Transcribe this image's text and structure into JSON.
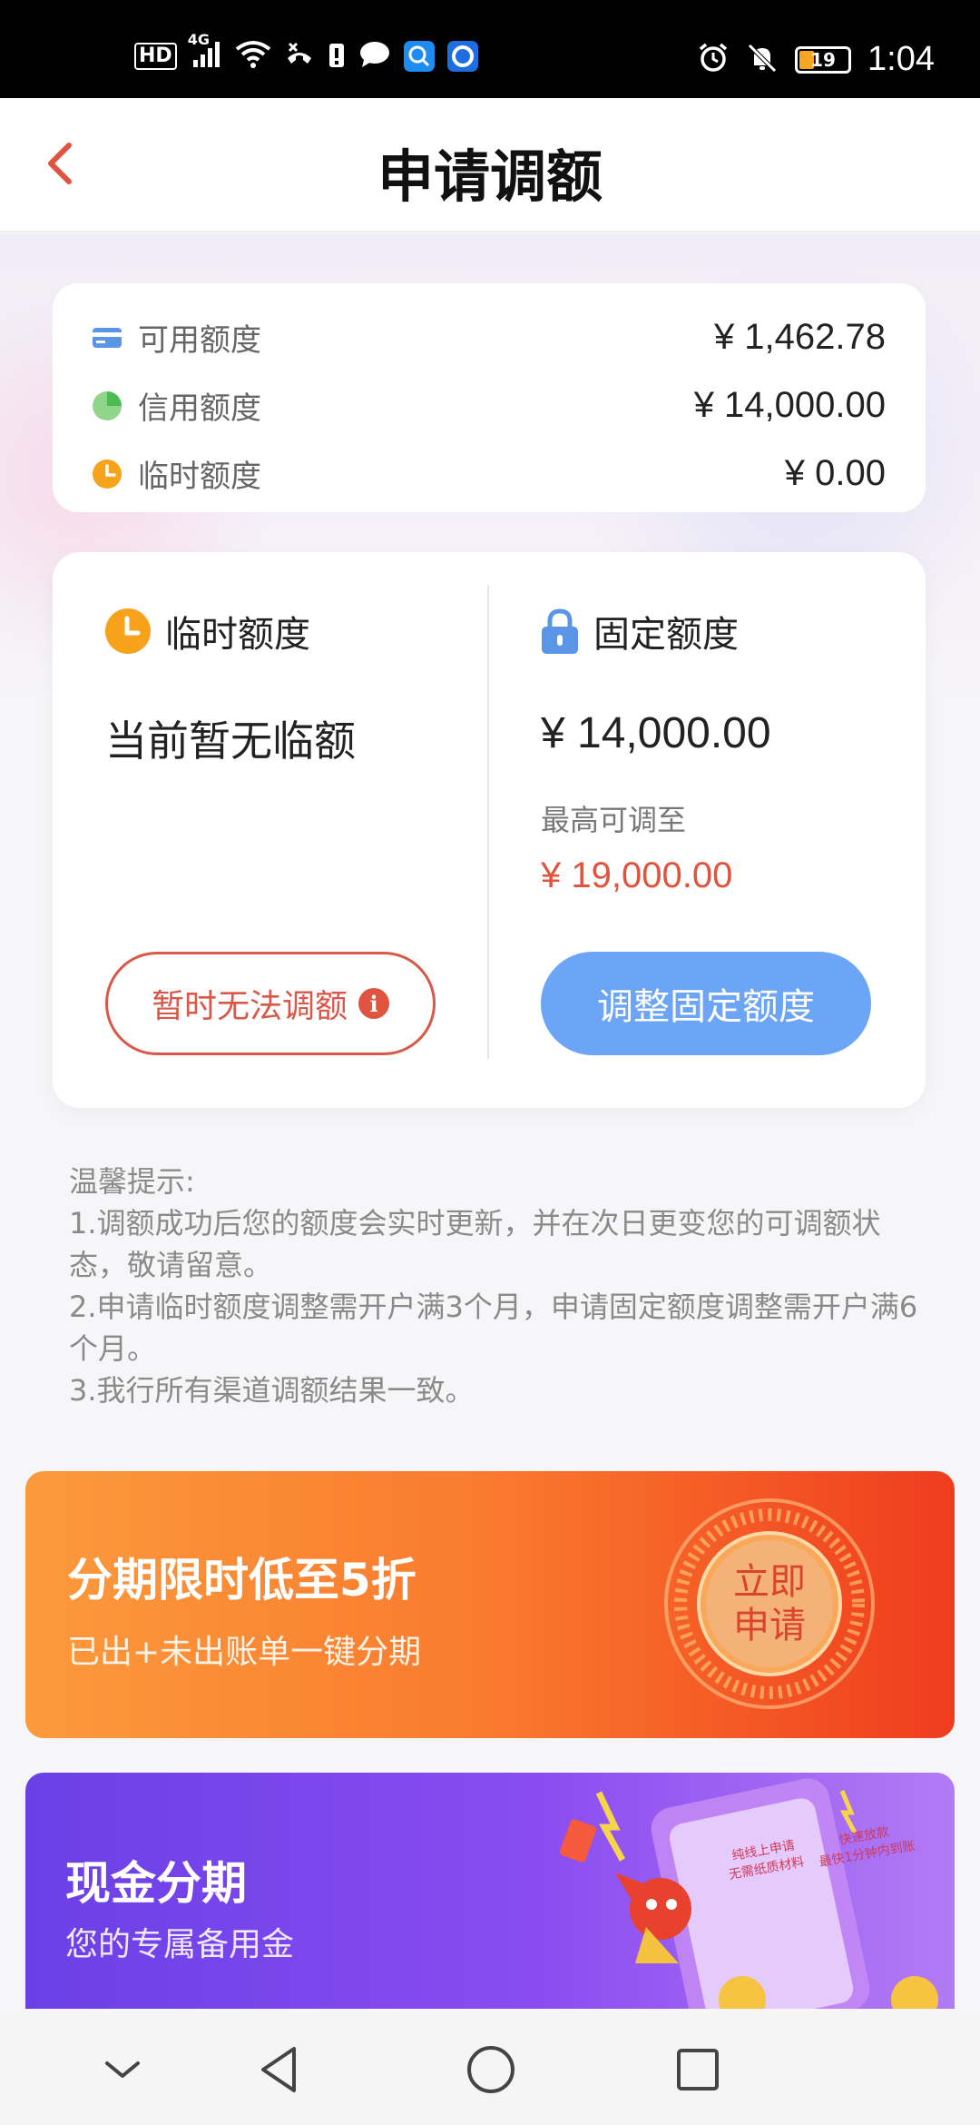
{
  "status_bar": {
    "hd": "HD",
    "network": "4G",
    "battery": "19",
    "time": "1:04"
  },
  "header": {
    "title": "申请调额"
  },
  "summary": {
    "rows": [
      {
        "label": "可用额度",
        "value": "¥ 1,462.78",
        "icon": "card-icon"
      },
      {
        "label": "信用额度",
        "value": "¥ 14,000.00",
        "icon": "pie-icon"
      },
      {
        "label": "临时额度",
        "value": "¥ 0.00",
        "icon": "clock-icon"
      }
    ]
  },
  "temp_limit": {
    "title": "临时额度",
    "status": "当前暂无临额",
    "button": "暂时无法调额"
  },
  "fixed_limit": {
    "title": "固定额度",
    "value": "¥ 14,000.00",
    "max_label": "最高可调至",
    "max_value": "¥ 19,000.00",
    "button": "调整固定额度"
  },
  "tips": {
    "heading": "温馨提示:",
    "line1": "1.调额成功后您的额度会实时更新，并在次日更变您的可调额状态，敬请留意。",
    "line2": "2.申请临时额度调整需开户满3个月，申请固定额度调整需开户满6个月。",
    "line3": "3.我行所有渠道调额结果一致。"
  },
  "banner_installment": {
    "title": "分期限时低至5折",
    "subtitle": "已出+未出账单一键分期",
    "badge_line1": "立即",
    "badge_line2": "申请"
  },
  "banner_cash": {
    "title": "现金分期",
    "subtitle": "您的专属备用金",
    "tag1_line1": "纯线上申请",
    "tag1_line2": "无需纸质材料",
    "tag2_line1": "快速放款",
    "tag2_line2": "最快1分钟内到账"
  },
  "colors": {
    "accent_red": "#e0533e",
    "button_blue": "#6ca4f6"
  }
}
